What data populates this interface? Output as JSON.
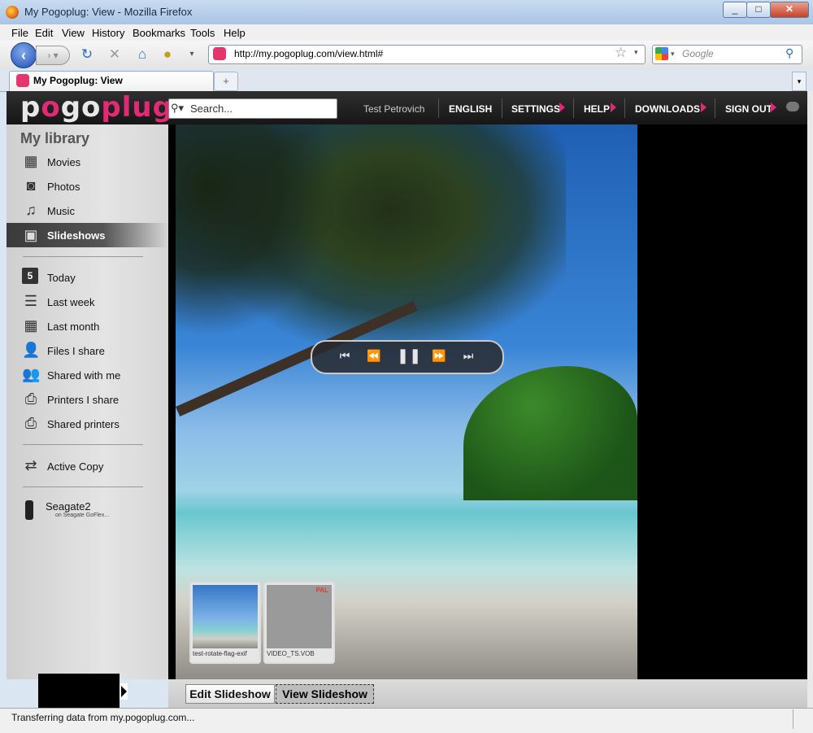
{
  "window": {
    "title": "My Pogoplug: View - Mozilla Firefox",
    "min": "_",
    "max": "□",
    "close": "✕"
  },
  "menubar": {
    "items": [
      "File",
      "Edit",
      "View",
      "History",
      "Bookmarks",
      "Tools",
      "Help"
    ]
  },
  "navbar": {
    "url": "http://my.pogoplug.com/view.html#",
    "search_placeholder": "Google"
  },
  "tabs": [
    {
      "label": "My Pogoplug: View"
    }
  ],
  "header": {
    "logo": {
      "part1": "p",
      "part2": "o",
      "part3": "go",
      "part4": "plug"
    },
    "search_placeholder": "Search...",
    "user": "Test Petrovich",
    "links": [
      "ENGLISH",
      "SETTINGS",
      "HELP",
      "DOWNLOADS",
      "SIGN OUT"
    ]
  },
  "sidebar": {
    "title": "My library",
    "library": [
      {
        "label": "Movies",
        "icon": "film-icon"
      },
      {
        "label": "Photos",
        "icon": "camera-icon"
      },
      {
        "label": "Music",
        "icon": "music-note-icon"
      },
      {
        "label": "Slideshows",
        "icon": "slideshow-icon",
        "active": true
      }
    ],
    "filters": [
      {
        "label": "Today",
        "icon": "calendar-day-icon",
        "badge": "5"
      },
      {
        "label": "Last week",
        "icon": "calendar-week-icon"
      },
      {
        "label": "Last month",
        "icon": "calendar-month-icon"
      },
      {
        "label": "Files I share",
        "icon": "user-share-icon"
      },
      {
        "label": "Shared with me",
        "icon": "users-icon"
      },
      {
        "label": "Printers I share",
        "icon": "printer-share-icon"
      },
      {
        "label": "Shared printers",
        "icon": "printer-icon"
      }
    ],
    "active_copy": {
      "label": "Active Copy",
      "icon": "swap-arrows-icon"
    },
    "device": {
      "name": "Seagate2",
      "sub": "on Seagate GoFlex..."
    }
  },
  "viewer": {
    "thumbnails": [
      {
        "label": "test-rotate-flag-exif"
      },
      {
        "label": "VIDEO_TS.VOB"
      }
    ],
    "thumb2_badge": "PAL"
  },
  "bottom": {
    "edit_label": "Edit Slideshow",
    "view_label": "View Slideshow"
  },
  "status": {
    "text": "Transferring data from my.pogoplug.com..."
  },
  "colors": {
    "brand": "#e02a74",
    "header_bg": "#1e1e1e",
    "sidebar_bg": "#d7d7d7"
  }
}
